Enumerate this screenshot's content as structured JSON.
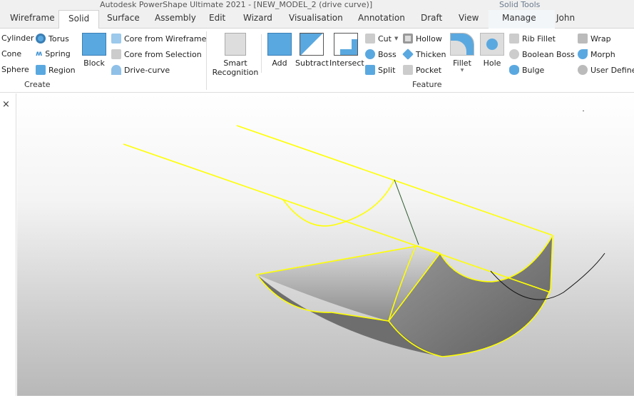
{
  "window": {
    "title": "Autodesk PowerShape Ultimate 2021 - [NEW_MODEL_2 (drive curve)]",
    "context_title": "Solid Tools"
  },
  "tabs": [
    "Wireframe",
    "Solid",
    "Surface",
    "Assembly",
    "Edit",
    "Wizard",
    "Visualisation",
    "Annotation",
    "Draft",
    "View",
    "Manage",
    "John"
  ],
  "ribbon": {
    "create": {
      "label": "Create",
      "items": [
        "Cylinder",
        "Torus",
        "Cone",
        "Spring",
        "Sphere",
        "Region",
        "Block",
        "Core from Wireframe",
        "Core from Selection",
        "Drive-curve"
      ]
    },
    "smart": "Smart Recognition",
    "feature": {
      "label": "Feature",
      "items": [
        "Add",
        "Subtract",
        "Intersect",
        "Cut",
        "Boss",
        "Split",
        "Hollow",
        "Thicken",
        "Pocket",
        "Fillet",
        "Hole",
        "Rib Fillet",
        "Boolean Boss",
        "Bulge",
        "Wrap",
        "Morph",
        "User Defined"
      ]
    }
  },
  "panel": {
    "close": "×"
  },
  "colors": {
    "accent": "#5aa8e0",
    "wire": "#ffff00",
    "solid": "#8a8a8a"
  }
}
